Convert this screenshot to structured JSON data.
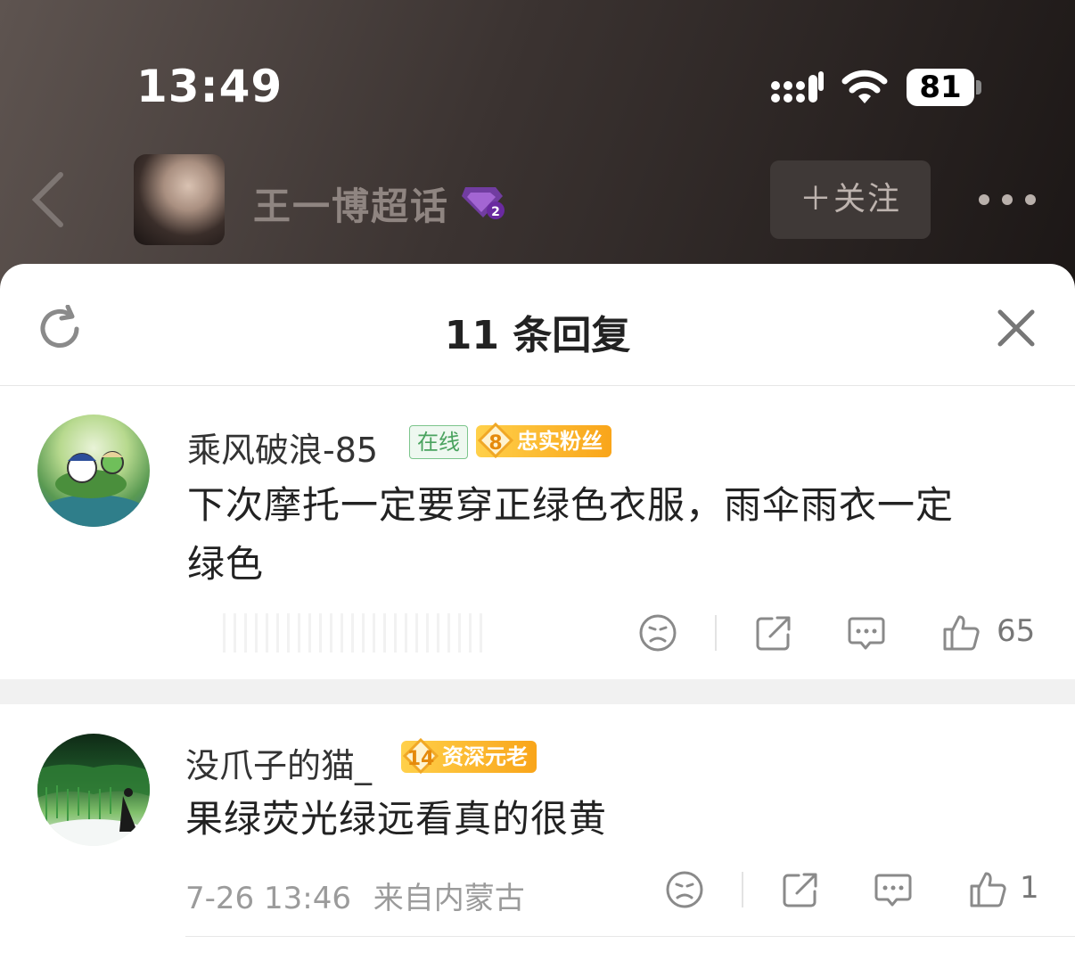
{
  "status_bar": {
    "time": "13:49",
    "battery": "81"
  },
  "header": {
    "title": "王一博超话",
    "follow_label": "＋关注"
  },
  "sheet": {
    "title": "11 条回复"
  },
  "comments": [
    {
      "username": "乘风破浪-85",
      "online_badge": "在线",
      "fan_level": "8",
      "fan_title": "忠实粉丝",
      "text_line1": "下次摩托一定要穿正绿色衣服，雨伞雨衣一定",
      "text_line2": "绿色",
      "likes": "65"
    },
    {
      "username": "没爪子的猫_",
      "fan_level": "14",
      "fan_title": "资深元老",
      "text_line1": "果绿荧光绿远看真的很黄",
      "date": "7-26 13:46",
      "location": "来自内蒙古",
      "likes": "1"
    }
  ],
  "icons": [
    "signal-icon",
    "wifi-icon",
    "back-icon",
    "gem-icon",
    "more-icon",
    "refresh-icon",
    "close-icon",
    "dislike-icon",
    "share-icon",
    "comment-icon",
    "like-icon"
  ]
}
